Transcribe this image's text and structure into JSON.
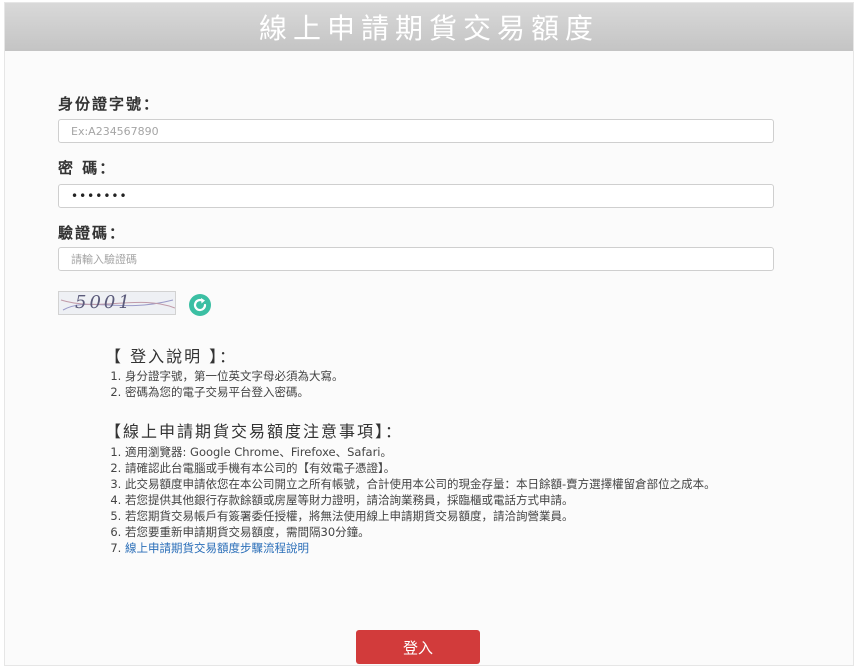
{
  "header": {
    "title": "線上申請期貨交易額度"
  },
  "form": {
    "id_label": "身份證字號：",
    "id_placeholder": "Ex:A234567890",
    "password_label": "密 碼：",
    "password_value": "•••••••",
    "captcha_label": "驗證碼：",
    "captcha_placeholder": "請輸入驗證碼",
    "captcha_text": "5001",
    "refresh_icon": "refresh-icon"
  },
  "login_notes": {
    "title": "【 登入說明 】：",
    "items": [
      "身分證字號，第一位英文字母必須為大寫。",
      "密碼為您的電子交易平台登入密碼。"
    ]
  },
  "quota_notes": {
    "title": "【線上申請期貨交易額度注意事項】：",
    "items": [
      "適用瀏覽器: Google Chrome、Firefoxe、Safari。",
      "請確認此台電腦或手機有本公司的【有效電子憑證】。",
      "此交易額度申請依您在本公司開立之所有帳號，合計使用本公司的現金存量：本日餘額-賣方選擇權留倉部位之成本。",
      "若您提供其他銀行存款餘額或房屋等財力證明，請洽詢業務員，採臨櫃或電話方式申請。",
      "若您期貨交易帳戶有簽署委任授權，將無法使用線上申請期貨交易額度，請洽詢營業員。",
      "若您要重新申請期貨交易額度，需間隔30分鐘。"
    ],
    "link_text": "線上申請期貨交易額度步驟流程說明"
  },
  "actions": {
    "login_label": "登入"
  },
  "colors": {
    "header": "#c9c9c9",
    "button": "#d23b3b",
    "link": "#2a6eb8",
    "refresh": "#3bbfa3"
  }
}
